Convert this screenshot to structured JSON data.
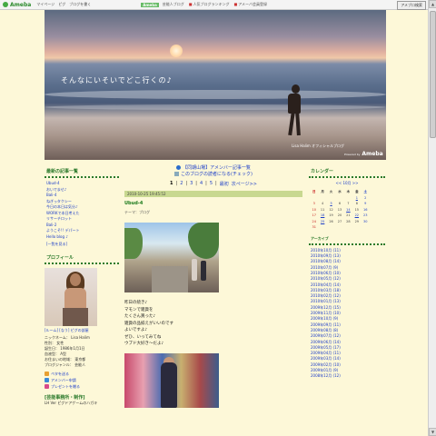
{
  "topbar": {
    "logo": "Ameba",
    "nav": [
      "マイページ",
      "ピグ",
      "ブログを書く"
    ],
    "badge": "Ameba",
    "right_nav": [
      "芸能人ブログ",
      "人気ブログランキング",
      "アメーバ会員登録"
    ],
    "search_button": "アメブロ検索"
  },
  "header": {
    "tagline": "そんなにいそいでどこ行くの♪",
    "blog_name": "Lisa Halim オフィシャルブログ",
    "powered_small": "Powered by",
    "powered_brand": "Ameba"
  },
  "left": {
    "section1_title": "最新の記事一覧",
    "recent": [
      "Ubud-4",
      "おいでませ♪",
      "Bali-4",
      "ねぎっタクシー",
      "今日の本日は気分♪",
      "WORKで本日考えた",
      "リサーチロット",
      "Bali-2",
      "ようこそ!! デパート",
      "Hello blog ♪"
    ],
    "recent_more": "[一覧を見る]",
    "section2_title": "プロフィール",
    "profile_caption": "[ルーム] [なう] ピグの部屋",
    "profile_lines": [
      "ニックネーム： Lisa Halim",
      "性別： 女性",
      "誕生日： 1986年1月1日",
      "血液型： A型",
      "お住まいの地域： 東京都",
      "ブログジャンル： 芸能人"
    ],
    "profile_links": [
      "ペタを送る",
      "アメンバー申請",
      "プレゼントを贈る"
    ],
    "bottom_title": "[芸能事務所・制作]",
    "bottom_sub": "LH Ver ピグドアゲームのハガキ"
  },
  "center": {
    "link1": "【同期山場】アメンバー記事一覧",
    "link2": "このブログの読者になる(チェック)",
    "pages": [
      "1",
      "2",
      "3",
      "4",
      "5"
    ],
    "last_label": "最初",
    "next_label": "次ページ>>",
    "date": "2010-10-25 19:45:52",
    "entry_title": "Ubud-4",
    "entry_theme": "テーマ：ブログ",
    "entry_body": [
      "昨日の続き♪",
      "マモンで雑貨を",
      "たくさん買った♪",
      "雑貨の品揃えがいいのです",
      "よいですよ♪",
      "ぜひ、いってみてね",
      "ウブド大好き〜だよ♪"
    ]
  },
  "right": {
    "calendar_title": "カレンダー",
    "cal_nav": "<< 10月 >>",
    "weekdays": [
      "日",
      "月",
      "火",
      "水",
      "木",
      "金",
      "土"
    ],
    "weeks": [
      [
        "",
        "",
        "",
        "",
        "",
        "1",
        "2"
      ],
      [
        "3",
        "4",
        "5",
        "6",
        "7",
        "8",
        "9"
      ],
      [
        "10",
        "11",
        "12",
        "13",
        "14",
        "15",
        "16"
      ],
      [
        "17",
        "18",
        "19",
        "20",
        "21",
        "22",
        "23"
      ],
      [
        "24",
        "25",
        "26",
        "27",
        "28",
        "29",
        "30"
      ],
      [
        "31",
        "",
        "",
        "",
        "",
        "",
        ""
      ]
    ],
    "archive_title": "アーカイブ",
    "archive": [
      "2010年10月 (11)",
      "2010年09月 (13)",
      "2010年08月 (14)",
      "2010年07月 (9)",
      "2010年06月 (10)",
      "2010年05月 (12)",
      "2010年04月 (14)",
      "2010年03月 (18)",
      "2010年02月 (12)",
      "2010年01月 (13)",
      "2009年12月 (15)",
      "2009年11月 (10)",
      "2009年10月 (9)",
      "2009年09月 (11)",
      "2009年08月 (8)",
      "2009年07月 (12)",
      "2009年06月 (14)",
      "2009年05月 (17)",
      "2009年04月 (11)",
      "2009年03月 (14)",
      "2009年02月 (10)",
      "2009年01月 (9)",
      "2008年12月 (12)"
    ]
  }
}
